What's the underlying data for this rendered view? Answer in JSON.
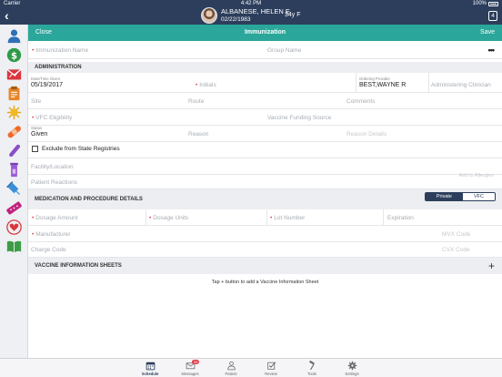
{
  "status_bar": {
    "carrier": "Carrier",
    "time": "4:42 PM",
    "battery": "100%"
  },
  "patient": {
    "name": "ALBANESE, HELEN E",
    "dob": "02/22/1983",
    "age_sex": "34y F",
    "badge": "4"
  },
  "header": {
    "close": "Close",
    "title": "Immunization",
    "save": "Save"
  },
  "form": {
    "immunization_name": "Immunization Name",
    "group_name": "Group Name",
    "more": "•••",
    "administration": {
      "section": "ADMINISTRATION",
      "date_label": "Date/Time Given",
      "date_value": "05/19/2017",
      "initials": "Initials",
      "ordering_label": "Ordering Provider",
      "ordering_value": "BEST,WAYNE R",
      "administering": "Administering Clinician",
      "site": "Site",
      "route": "Route",
      "comments": "Comments",
      "vfc_eligibility": "VFC Eligibility",
      "vaccine_funding": "Vaccine Funding Source",
      "status_label": "Status",
      "status_value": "Given",
      "reason": "Reason",
      "reason_details": "Reason Details",
      "exclude": "Exclude from State Registries",
      "facility": "Facility/Location",
      "add_allergies": "Add to Allergies",
      "patient_reactions": "Patient Reactions"
    },
    "medication": {
      "section": "MEDICATION AND PROCEDURE DETAILS",
      "toggle_private": "Private",
      "toggle_vfc": "VFC",
      "dosage_amount": "Dosage Amount",
      "dosage_units": "Dosage Units",
      "lot_number": "Lot Number",
      "expiration": "Expiration",
      "manufacturer": "Manufacturer",
      "mvx_code": "MVX Code",
      "charge_code": "Charge Code",
      "cvx_code": "CVX Code"
    },
    "vis": {
      "section": "VACCINE INFORMATION SHEETS",
      "hint": "Tap + button to add a Vaccine Information Sheet"
    }
  },
  "tabs": [
    {
      "label": "Schedule",
      "icon": "calendar-icon",
      "active": true
    },
    {
      "label": "Messages",
      "icon": "envelope-icon",
      "badge": "25"
    },
    {
      "label": "Patient",
      "icon": "person-icon"
    },
    {
      "label": "Review",
      "icon": "checkbox-icon"
    },
    {
      "label": "Tools",
      "icon": "hammer-icon"
    },
    {
      "label": "Settings",
      "icon": "gear-icon"
    }
  ],
  "sidebar_icons": [
    "person-icon",
    "dollar-icon",
    "chart-envelope-icon",
    "clipboard-icon",
    "virus-icon",
    "bandage-icon",
    "test-tube-icon",
    "vial-icon",
    "syringe-icon",
    "pill-bar-icon",
    "heart-icon",
    "book-icon"
  ],
  "colors": {
    "navy": "#2c3e5c",
    "teal": "#2aa79a",
    "required": "#e03c4b"
  }
}
